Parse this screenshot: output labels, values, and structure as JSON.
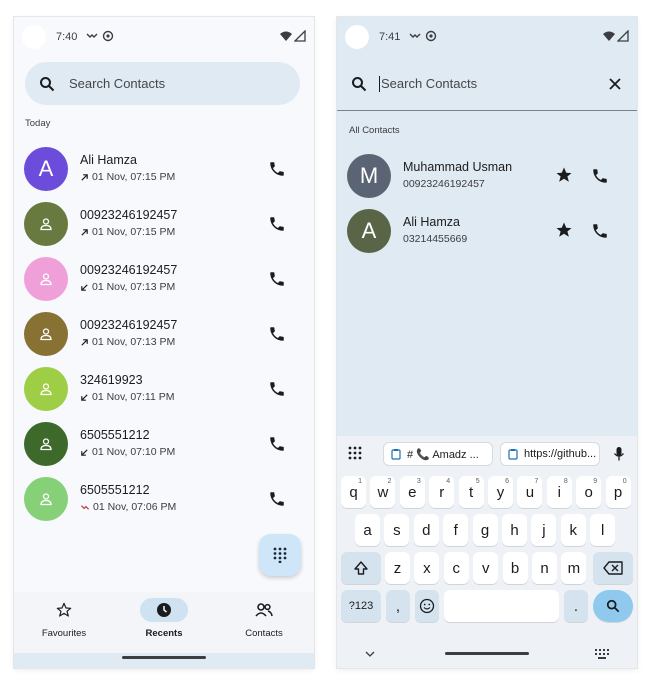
{
  "left": {
    "status_time": "7:40",
    "search_placeholder": "Search Contacts",
    "section_today": "Today",
    "recents": [
      {
        "avatar_letter": "A",
        "color": "#6c4ddb",
        "name": "Ali Hamza",
        "direction": "outgoing",
        "time": "01 Nov, 07:15 PM"
      },
      {
        "avatar_letter": "",
        "color": "#687a3f",
        "name": "00923246192457",
        "direction": "outgoing",
        "time": "01 Nov, 07:15 PM"
      },
      {
        "avatar_letter": "",
        "color": "#f0a0d8",
        "name": "00923246192457",
        "direction": "incoming",
        "time": "01 Nov, 07:13 PM"
      },
      {
        "avatar_letter": "",
        "color": "#877234",
        "name": "00923246192457",
        "direction": "outgoing",
        "time": "01 Nov, 07:13 PM"
      },
      {
        "avatar_letter": "",
        "color": "#9dce45",
        "name": "324619923",
        "direction": "incoming",
        "time": "01 Nov, 07:11 PM"
      },
      {
        "avatar_letter": "",
        "color": "#3d6a2b",
        "name": "6505551212",
        "direction": "incoming",
        "time": "01 Nov, 07:10 PM"
      },
      {
        "avatar_letter": "",
        "color": "#86d077",
        "name": "6505551212",
        "direction": "missed",
        "time": "01 Nov, 07:06 PM"
      }
    ],
    "nav": [
      {
        "label": "Favourites",
        "icon": "star-outline-icon",
        "active": false
      },
      {
        "label": "Recents",
        "icon": "clock-icon",
        "active": true
      },
      {
        "label": "Contacts",
        "icon": "people-icon",
        "active": false
      }
    ]
  },
  "right": {
    "status_time": "7:41",
    "search_placeholder": "Search Contacts",
    "section_all": "All Contacts",
    "contacts": [
      {
        "avatar_letter": "M",
        "color": "#5b6474",
        "name": "Muhammad Usman",
        "phone": "00923246192457"
      },
      {
        "avatar_letter": "A",
        "color": "#5a6548",
        "name": "Ali Hamza",
        "phone": "03214455669"
      }
    ],
    "keyboard": {
      "suggestions": [
        "# 📞 Amadz ...",
        "https://github..."
      ],
      "row1": [
        "q",
        "w",
        "e",
        "r",
        "t",
        "y",
        "u",
        "i",
        "o",
        "p"
      ],
      "row1_hints": [
        "1",
        "2",
        "3",
        "4",
        "5",
        "6",
        "7",
        "8",
        "9",
        "0"
      ],
      "row2": [
        "a",
        "s",
        "d",
        "f",
        "g",
        "h",
        "j",
        "k",
        "l"
      ],
      "row3": [
        "z",
        "x",
        "c",
        "v",
        "b",
        "n",
        "m"
      ],
      "sym_label": "?123",
      "comma": ",",
      "period": "."
    }
  },
  "colors": {
    "accent": "#cfe2f1",
    "search_bg": "#dfeaf2",
    "search_key": "#8fc9ee"
  }
}
